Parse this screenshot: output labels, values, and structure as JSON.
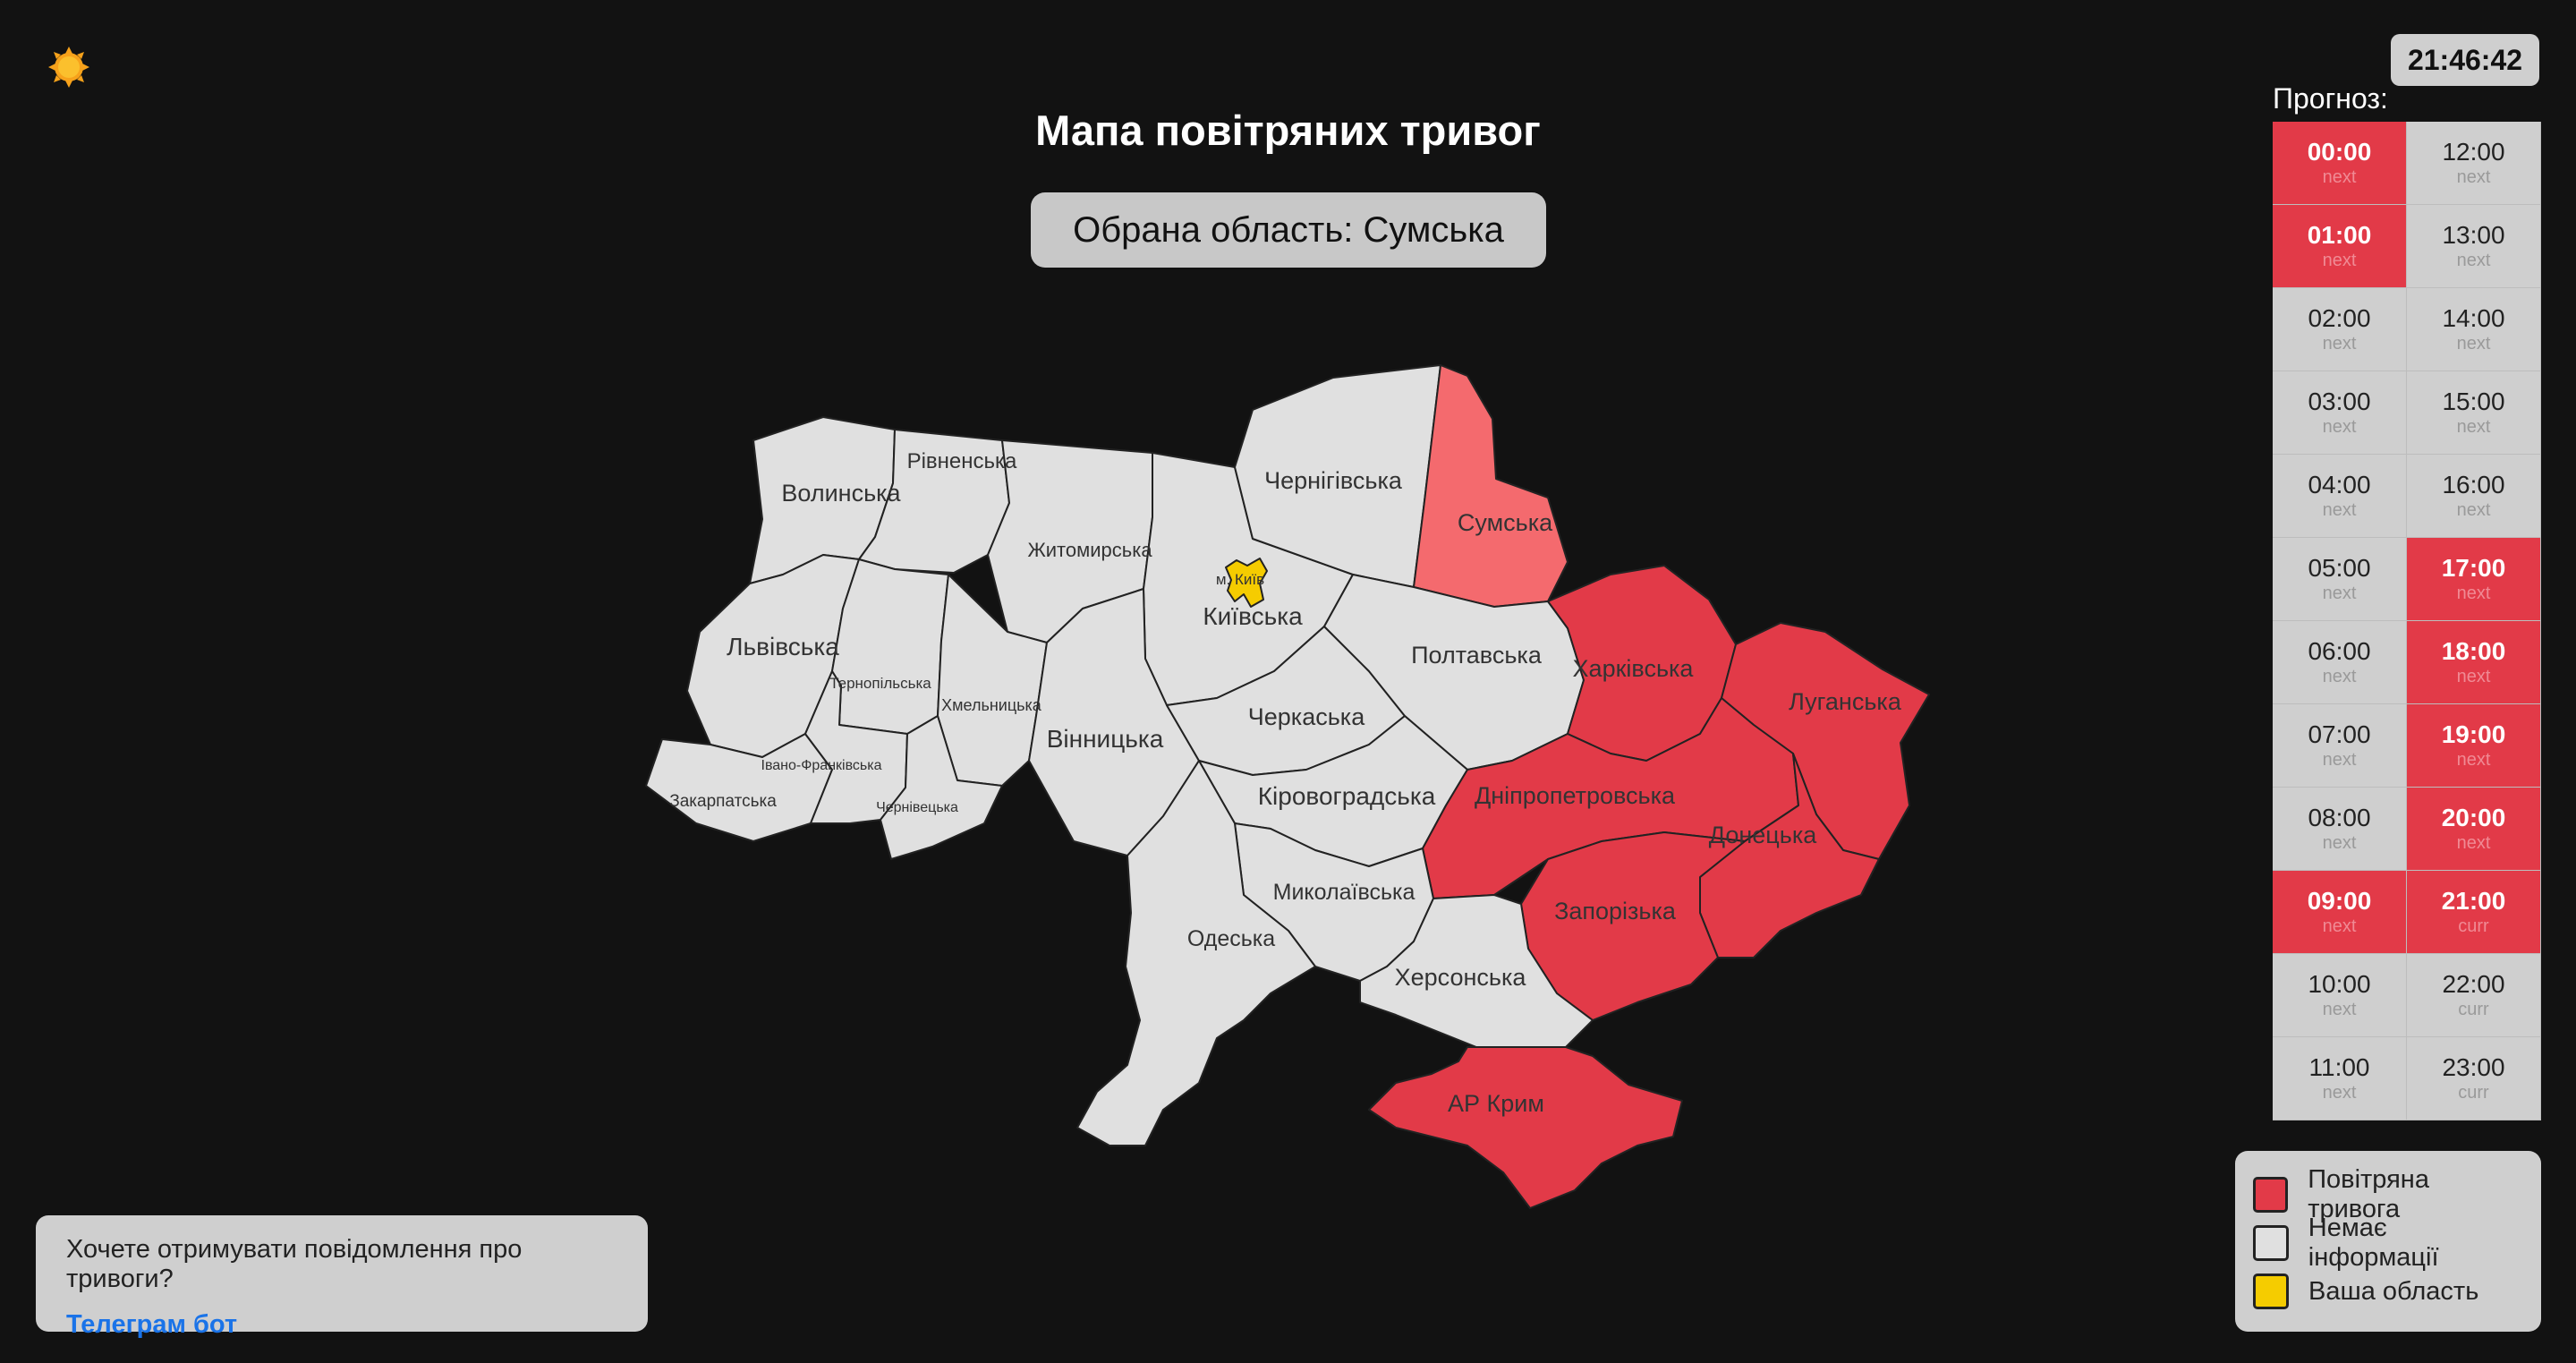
{
  "header": {
    "title": "Мапа повітряних тривог"
  },
  "selected_region": {
    "label": "Обрана область: Сумська"
  },
  "clock": {
    "time": "21:46:42"
  },
  "theme_toggle": {
    "icon": "sun-icon"
  },
  "forecast": {
    "label": "Прогноз:",
    "slots": [
      {
        "time": "00:00",
        "status": "next",
        "alert": true
      },
      {
        "time": "12:00",
        "status": "next",
        "alert": false
      },
      {
        "time": "01:00",
        "status": "next",
        "alert": true
      },
      {
        "time": "13:00",
        "status": "next",
        "alert": false
      },
      {
        "time": "02:00",
        "status": "next",
        "alert": false
      },
      {
        "time": "14:00",
        "status": "next",
        "alert": false
      },
      {
        "time": "03:00",
        "status": "next",
        "alert": false
      },
      {
        "time": "15:00",
        "status": "next",
        "alert": false
      },
      {
        "time": "04:00",
        "status": "next",
        "alert": false
      },
      {
        "time": "16:00",
        "status": "next",
        "alert": false
      },
      {
        "time": "05:00",
        "status": "next",
        "alert": false
      },
      {
        "time": "17:00",
        "status": "next",
        "alert": true
      },
      {
        "time": "06:00",
        "status": "next",
        "alert": false
      },
      {
        "time": "18:00",
        "status": "next",
        "alert": true
      },
      {
        "time": "07:00",
        "status": "next",
        "alert": false
      },
      {
        "time": "19:00",
        "status": "next",
        "alert": true
      },
      {
        "time": "08:00",
        "status": "next",
        "alert": false
      },
      {
        "time": "20:00",
        "status": "next",
        "alert": true
      },
      {
        "time": "09:00",
        "status": "next",
        "alert": true
      },
      {
        "time": "21:00",
        "status": "curr",
        "alert": true
      },
      {
        "time": "10:00",
        "status": "next",
        "alert": false
      },
      {
        "time": "22:00",
        "status": "curr",
        "alert": false
      },
      {
        "time": "11:00",
        "status": "next",
        "alert": false
      },
      {
        "time": "23:00",
        "status": "curr",
        "alert": false
      }
    ]
  },
  "legend": {
    "items": [
      {
        "label": "Повітряна тривога",
        "color": "#e23a48"
      },
      {
        "label": "Немає інформації",
        "color": "#e0e0e0"
      },
      {
        "label": "Ваша область",
        "color": "#f5cc00"
      }
    ]
  },
  "notify": {
    "text": "Хочете отримувати повідомлення про тривоги?",
    "link_label": "Телеграм бот"
  },
  "colors": {
    "alert": "#e23a48",
    "selected_alert": "#f46a6e",
    "no_info": "#e0e0e0",
    "your_region": "#f5cc00"
  },
  "map": {
    "regions": {
      "volynska": {
        "label": "Волинська",
        "state": "none"
      },
      "rivnenska": {
        "label": "Рівненська",
        "state": "none"
      },
      "zhytomyrska": {
        "label": "Житомирська",
        "state": "none"
      },
      "kyivska": {
        "label": "Київська",
        "state": "none"
      },
      "kyiv_city": {
        "label": "м. Київ",
        "state": "yours"
      },
      "chernihivska": {
        "label": "Чернігівська",
        "state": "none"
      },
      "sumska": {
        "label": "Сумська",
        "state": "selected-alert"
      },
      "lvivska": {
        "label": "Львівська",
        "state": "none"
      },
      "ternopilska": {
        "label": "Тернопільська",
        "state": "none"
      },
      "khmelnytska": {
        "label": "Хмельницька",
        "state": "none"
      },
      "vinnytska": {
        "label": "Вінницька",
        "state": "none"
      },
      "cherkaska": {
        "label": "Черкаська",
        "state": "none"
      },
      "poltavska": {
        "label": "Полтавська",
        "state": "none"
      },
      "kharkivska": {
        "label": "Харківська",
        "state": "alert"
      },
      "luhanska": {
        "label": "Луганська",
        "state": "alert"
      },
      "zakarpatska": {
        "label": "Закарпатська",
        "state": "none"
      },
      "ivano_frankivska": {
        "label": "Івано-Франківська",
        "state": "none"
      },
      "chernivetska": {
        "label": "Чернівецька",
        "state": "none"
      },
      "kirovohradska": {
        "label": "Кіровоградська",
        "state": "none"
      },
      "dnipropetrovska": {
        "label": "Дніпропетровська",
        "state": "alert"
      },
      "donetska": {
        "label": "Донецька",
        "state": "alert"
      },
      "zaporizka": {
        "label": "Запорізька",
        "state": "alert"
      },
      "mykolaivska": {
        "label": "Миколаївська",
        "state": "none"
      },
      "odeska": {
        "label": "Одеська",
        "state": "none"
      },
      "khersonska": {
        "label": "Херсонська",
        "state": "none"
      },
      "crimea": {
        "label": "АР Крим",
        "state": "alert"
      }
    }
  }
}
